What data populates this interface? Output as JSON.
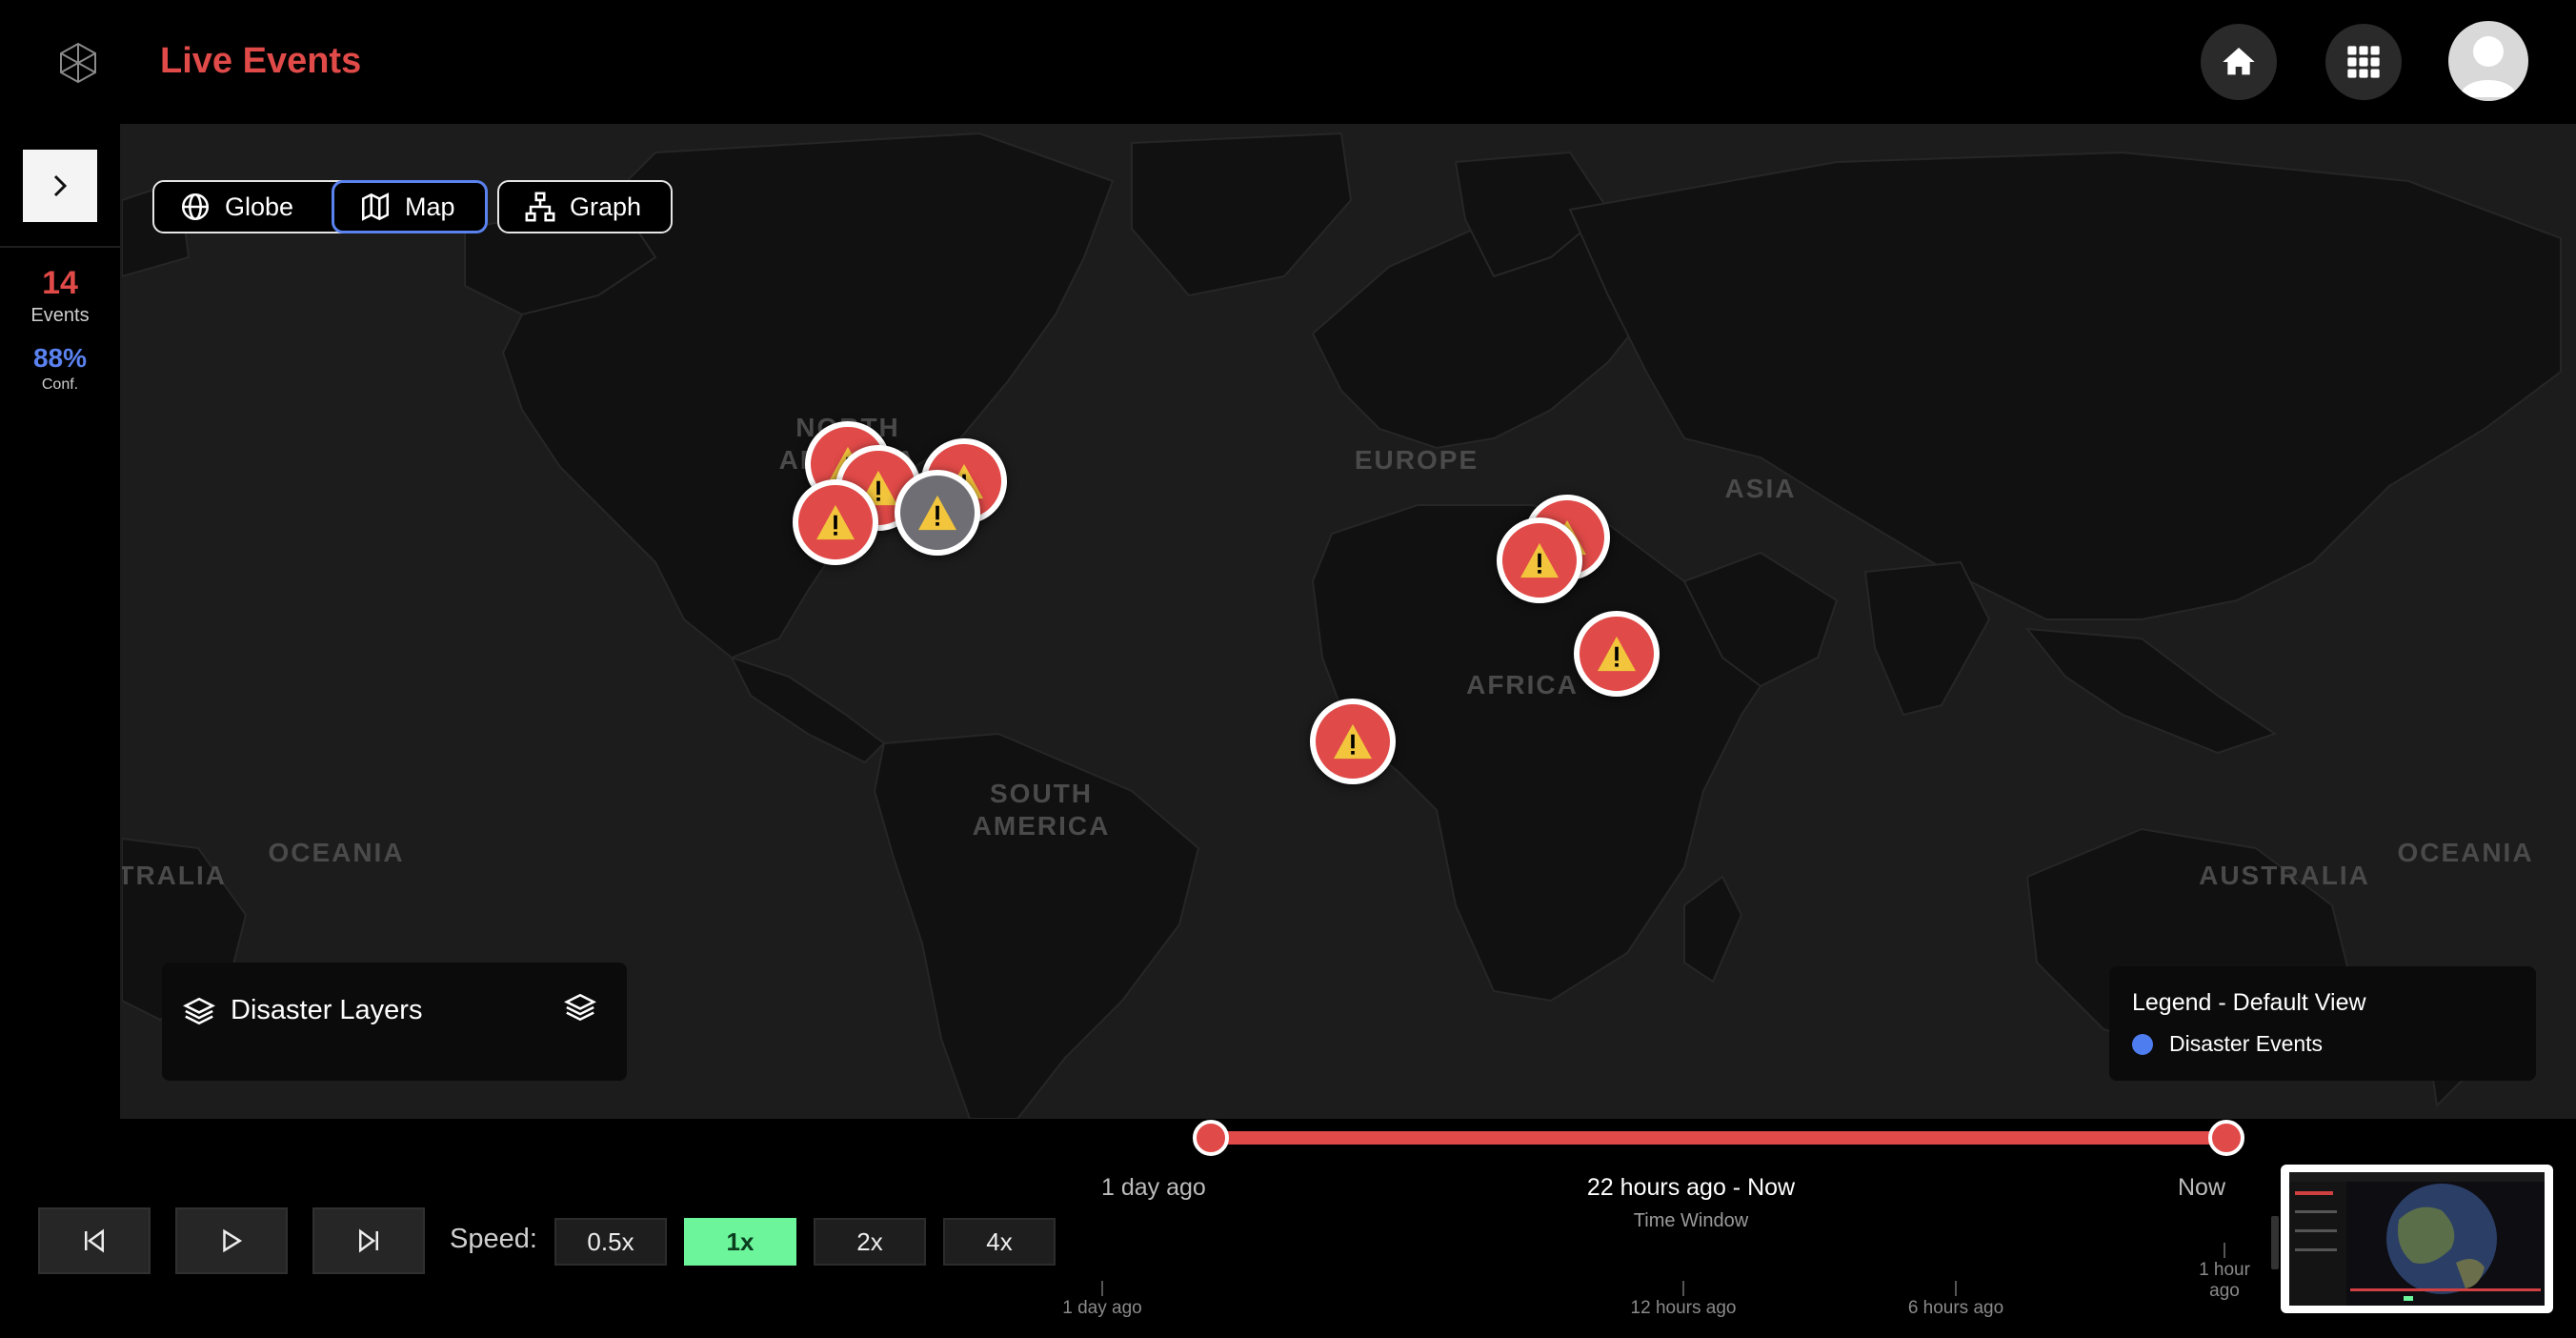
{
  "header": {
    "title": "Live Events"
  },
  "stats": {
    "events_count": "14",
    "events_label": "Events",
    "confidence": "88%",
    "confidence_label": "Conf."
  },
  "view_tabs": [
    {
      "label": "Globe",
      "active": false
    },
    {
      "label": "Map",
      "active": true
    },
    {
      "label": "Graph",
      "active": false
    }
  ],
  "map": {
    "regions": [
      "NORTH AMERICA",
      "EUROPE",
      "ASIA",
      "AFRICA",
      "SOUTH AMERICA",
      "OCEANIA",
      "AUSTRALIA",
      "OCEANIA",
      "AUSTRALIA"
    ],
    "marker_icon": "warning-icon"
  },
  "layers_panel": {
    "title": "Disaster Layers"
  },
  "legend": {
    "title": "Legend - Default View",
    "items": [
      {
        "label": "Disaster Events",
        "color": "#4e7df0"
      }
    ]
  },
  "timeline": {
    "start_label": "1 day ago",
    "end_label": "Now",
    "range_label": "22 hours ago - Now",
    "range_caption": "Time Window",
    "ticks": [
      "1 day ago",
      "12 hours ago",
      "6 hours ago",
      "1 hour ago"
    ]
  },
  "playback": {
    "speed_label": "Speed:",
    "speeds": [
      "0.5x",
      "1x",
      "2x",
      "4x"
    ],
    "active_speed": "1x"
  },
  "colors": {
    "accent": "#e04a48",
    "active_tab": "#5a82f0",
    "speed_active": "#6cf59b",
    "legend_dot": "#4e7df0"
  }
}
